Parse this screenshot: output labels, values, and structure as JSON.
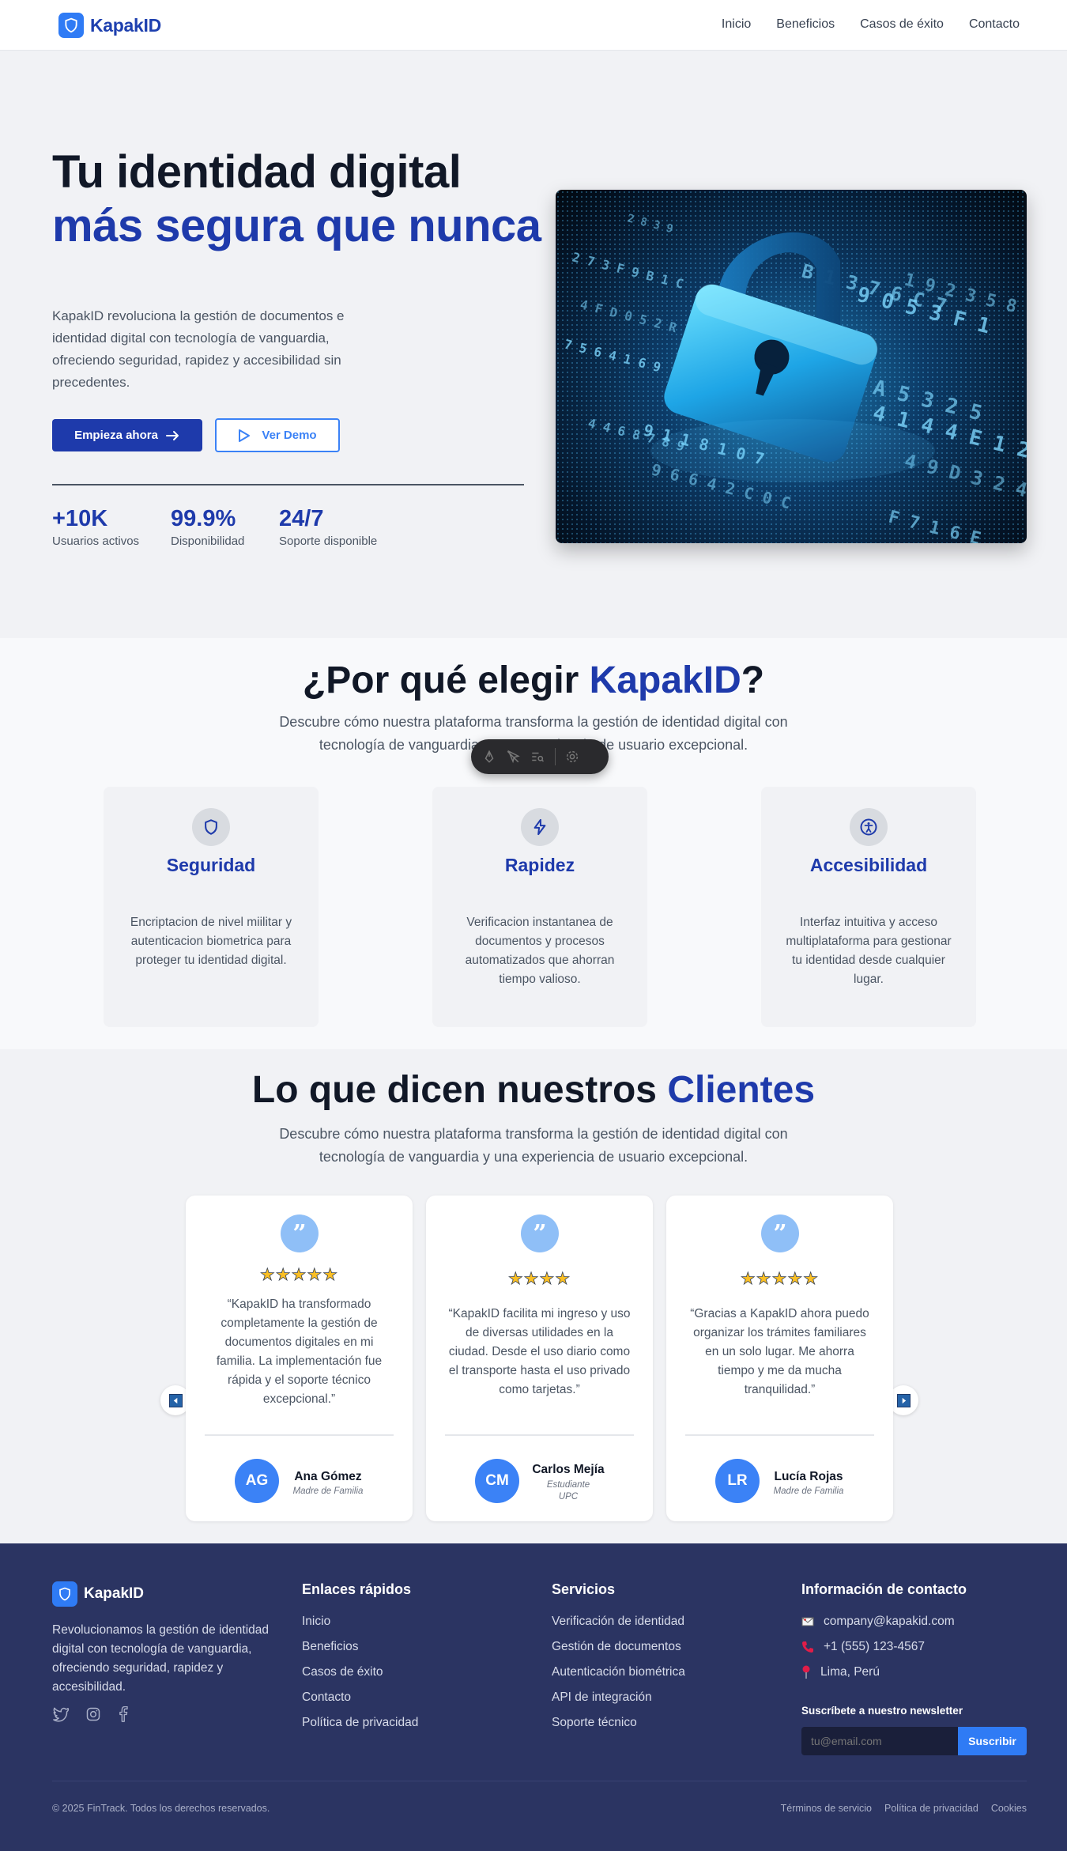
{
  "brand": {
    "name": "KapakID"
  },
  "nav": {
    "links": [
      "Inicio",
      "Beneficios",
      "Casos de éxito",
      "Contacto"
    ]
  },
  "hero": {
    "title_line1": "Tu identidad digital",
    "title_highlight": "más segura que nunca",
    "description": "KapakID revoluciona la gestión de documentos e identidad digital con tecnología de vanguardia, ofreciendo seguridad, rapidez y accesibilidad sin precedentes.",
    "primary_button": "Empieza ahora",
    "secondary_button": "Ver Demo",
    "stats": [
      {
        "value": "+10K",
        "label": "Usuarios activos"
      },
      {
        "value": "99.9%",
        "label": "Disponibilidad"
      },
      {
        "value": "24/7",
        "label": "Soporte disponible"
      }
    ],
    "image_codes": [
      "2 8 3 9",
      "B 1 3 7 6 C 7",
      "9 0 5 3 F 1",
      "1 9 2 3 5 8 9 A",
      "E A 5 3 2 5",
      "4 1 4 4 E 1 2 2 7",
      "4 9 D 3 2 4 F",
      "F 7 1 6 E",
      "9 1 1 8 1 0 7",
      "9 6 6 4 2 C 0 C",
      "4 4 6 8 7 8 9",
      "7 5 6 4 1 6 9",
      "4 F D 0 5 2 R",
      "2 7 3 F 9 B 1 C"
    ]
  },
  "why": {
    "title_prefix": "¿Por qué elegir ",
    "title_highlight": "KapakID",
    "title_suffix": "?",
    "subtitle": "Descubre cómo nuestra plataforma transforma la gestión de identidad digital con tecnología de vanguardia y una experiencia de usuario excepcional.",
    "features": [
      {
        "title": "Seguridad",
        "description": "Encriptacion de nivel miilitar y autenticacion biometrica para proteger tu identidad digital.",
        "icon": "shield-icon"
      },
      {
        "title": "Rapidez",
        "description": "Verificacion instantanea de documentos y procesos automatizados que ahorran tiempo valioso.",
        "icon": "lightning-icon"
      },
      {
        "title": "Accesibilidad",
        "description": "Interfaz intuitiva y acceso multiplataforma para gestionar tu identidad desde cualquier lugar.",
        "icon": "accessibility-icon"
      }
    ]
  },
  "testimonials": {
    "title_prefix": "Lo que dicen nuestros ",
    "title_highlight": "Clientes",
    "subtitle": "Descubre cómo nuestra plataforma transforma la gestión de identidad digital con tecnología de vanguardia y una experiencia de usuario excepcional.",
    "items": [
      {
        "quote": "“KapakID ha transformado completamente la gestión de documentos digitales en mi familia. La implementación fue rápida y el soporte técnico excepcional.”",
        "stars": "★★★★★",
        "initials": "AG",
        "name": "Ana Gómez",
        "role": "Madre de Familia"
      },
      {
        "quote": "“KapakID facilita mi ingreso y uso de diversas utilidades en la ciudad. Desde el uso diario como el transporte hasta el uso privado como tarjetas.”",
        "stars": "★★★★",
        "initials": "CM",
        "name": "Carlos Mejía",
        "role": "Estudiante UPC"
      },
      {
        "quote": "“Gracias a KapakID ahora puedo organizar los trámites familiares en un solo lugar. Me ahorra tiempo y me da mucha tranquilidad.”",
        "stars": "★★★★★",
        "initials": "LR",
        "name": "Lucía Rojas",
        "role": "Madre de Familia"
      }
    ]
  },
  "footer": {
    "about": "Revolucionamos la gestión de identidad digital con tecnología de vanguardia, ofreciendo seguridad, rapidez y accesibilidad.",
    "quick_links_title": "Enlaces rápidos",
    "quick_links": [
      "Inicio",
      "Beneficios",
      "Casos de éxito",
      "Contacto",
      "Política de privacidad"
    ],
    "services_title": "Servicios",
    "services": [
      "Verificación de identidad",
      "Gestión de documentos",
      "Autenticación biométrica",
      "API de integración",
      "Soporte técnico"
    ],
    "contact_title": "Información de contacto",
    "contact": [
      {
        "icon": "envelope-icon",
        "text": "company@kapakid.com"
      },
      {
        "icon": "phone-icon",
        "text": "+1 (555) 123-4567"
      },
      {
        "icon": "pin-icon",
        "text": "Lima, Perú"
      }
    ],
    "newsletter_title": "Suscríbete a nuestro newsletter",
    "newsletter_placeholder": "tu@email.com",
    "newsletter_button": "Suscribir",
    "copyright": "© 2025 FinTrack. Todos los derechos reservados.",
    "legal": [
      "Términos de servicio",
      "Política de privacidad",
      "Cookies"
    ]
  },
  "colors": {
    "primary": "#1e3aab",
    "accent": "#2f7bf5",
    "footer_bg": "#2b3462",
    "star": "#fbbf24"
  }
}
